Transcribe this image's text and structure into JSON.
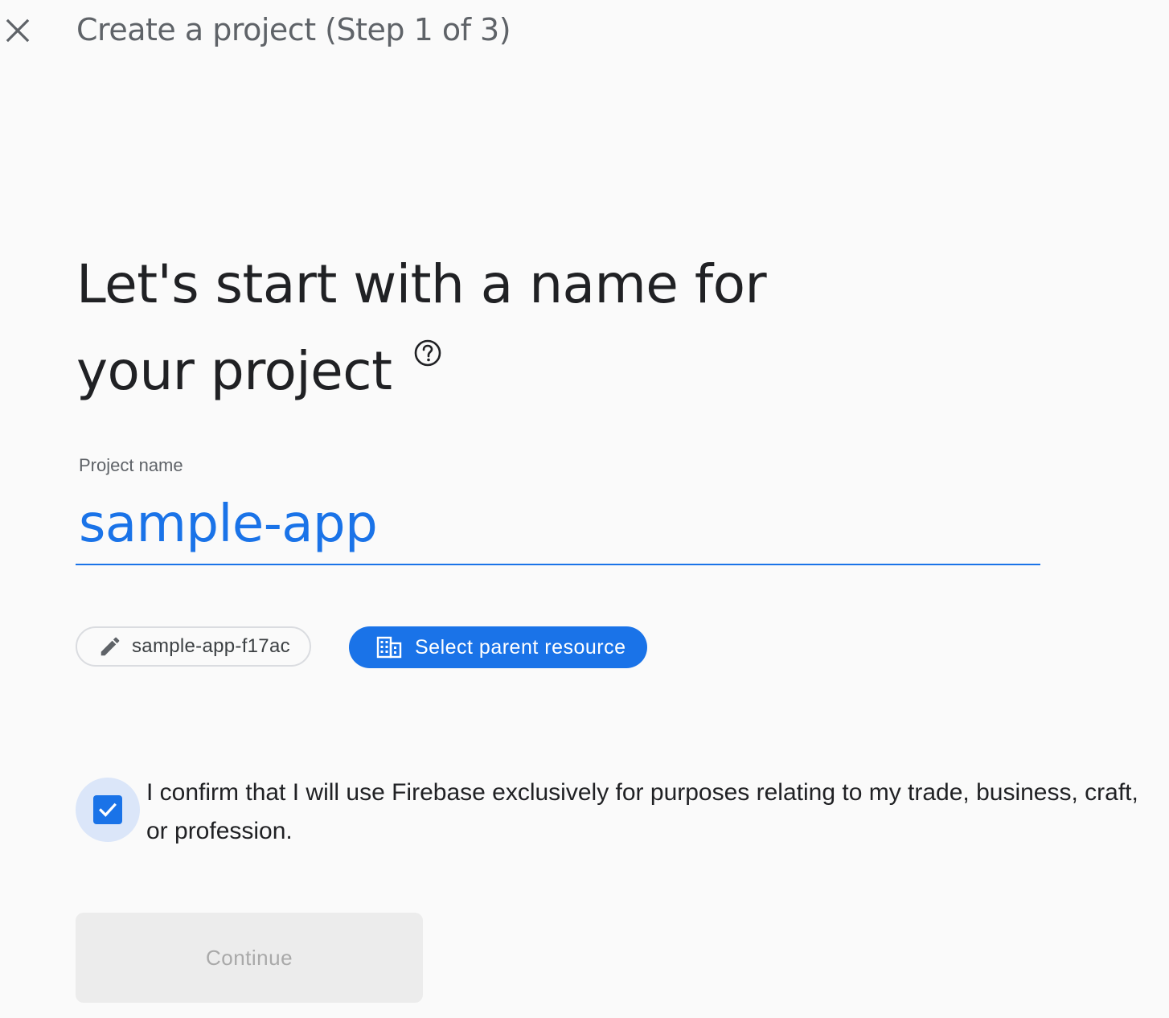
{
  "header": {
    "title": "Create a project (Step 1 of 3)",
    "close_icon": "close-icon"
  },
  "main": {
    "title_line1": "Let's start with a name for",
    "title_line2": "your project",
    "help_icon": "help-circle-icon"
  },
  "form": {
    "project_name_label": "Project name",
    "project_name_value": "sample-app",
    "project_id_chip": {
      "icon": "pencil-icon",
      "label": "sample-app-f17ac"
    },
    "parent_resource_chip": {
      "icon": "building-icon",
      "label": "Select parent resource"
    },
    "confirm": {
      "checked": true,
      "text": "I confirm that I will use Firebase exclusively for purposes relating to my trade, business, craft, or profession."
    },
    "continue_label": "Continue"
  },
  "colors": {
    "accent": "#1a73e8",
    "background": "#fafafa",
    "disabled_bg": "#ececec",
    "disabled_text": "#a9a9a9"
  }
}
